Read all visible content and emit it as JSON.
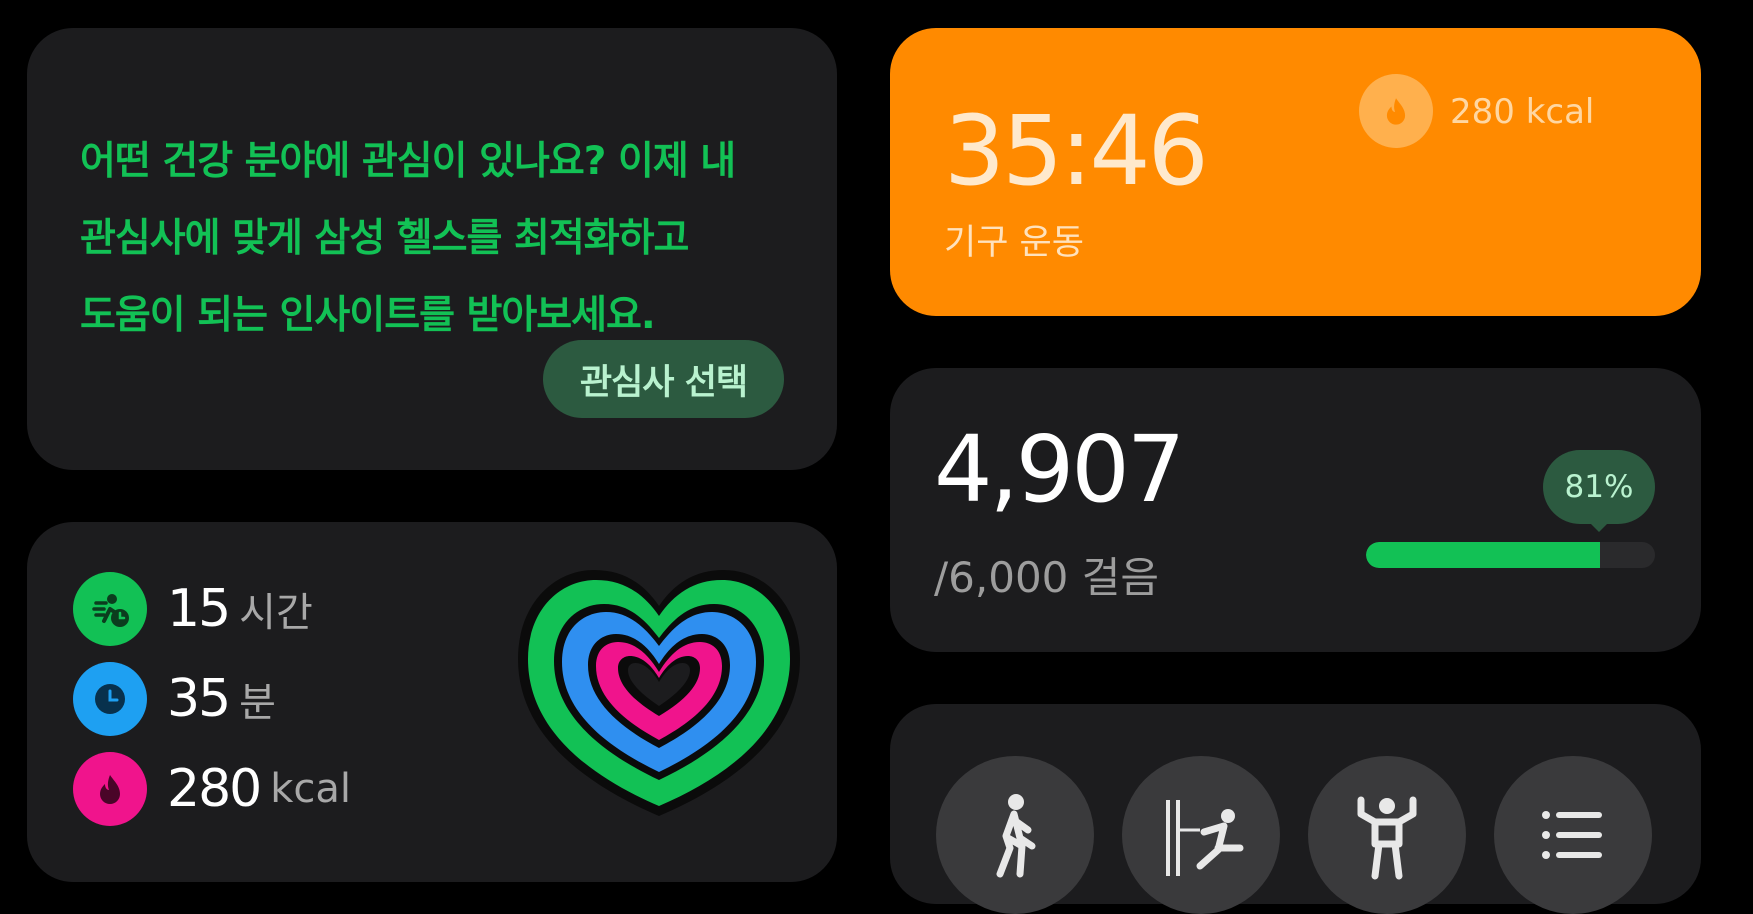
{
  "interest_card": {
    "lines": [
      "어떤 건강 분야에 관심이 있나요? 이제 내",
      "관심사에 맞게 삼성 헬스를 최적화하고",
      "도움이 되는 인사이트를 받아보세요."
    ],
    "button_label": "관심사 선택"
  },
  "activity": {
    "active_time": {
      "value": "15",
      "unit": "시간",
      "icon": "running-clock-icon",
      "color": "#12c155"
    },
    "activity_minutes": {
      "value": "35",
      "unit": "분",
      "icon": "clock-icon",
      "color": "#1ea0f2"
    },
    "calories": {
      "value": "280",
      "unit": "kcal",
      "icon": "flame-icon",
      "color": "#f0148c"
    },
    "rings_icon": "heart-rings-icon"
  },
  "exercise": {
    "duration": "35:46",
    "label": "기구 운동",
    "calories": "280",
    "calories_unit": "kcal",
    "icon": "flame-icon",
    "accent": "#ff8a00"
  },
  "steps": {
    "count": "4,907",
    "goal": "/6,000 걸음",
    "percent_label": "81%",
    "progress": 0.81,
    "accent": "#12c155"
  },
  "workouts": {
    "buttons": [
      {
        "icon": "walking-icon"
      },
      {
        "icon": "cable-machine-icon"
      },
      {
        "icon": "strength-icon"
      },
      {
        "icon": "list-icon"
      }
    ]
  }
}
